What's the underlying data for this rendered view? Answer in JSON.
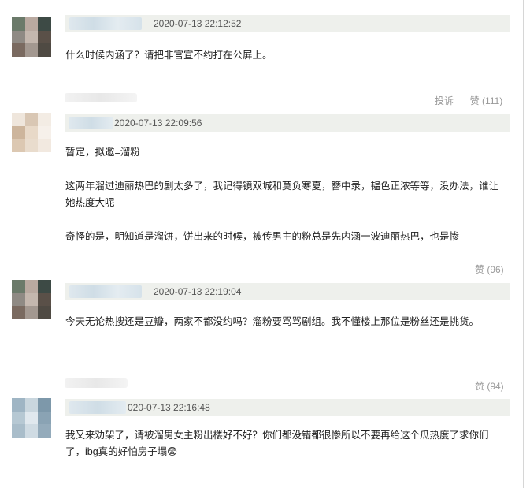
{
  "comments": [
    {
      "date": "2020-07-13 22:12:52",
      "lines": [
        "什么时候内涵了？请把非官宣不约打在公屏上。"
      ],
      "report_label": "投诉",
      "like_label": "赞 (111)",
      "avatar_colors": [
        "#6b7a6a",
        "#b9a9a0",
        "#3d4a45",
        "#8f8a84",
        "#c4b7ae",
        "#5a5048",
        "#7a6a60",
        "#a39890",
        "#4f4a43"
      ]
    },
    {
      "date": "2020-07-13 22:09:56",
      "lines": [
        "暂定，拟邀=溜粉",
        "这两年溜过迪丽热巴的剧太多了，我记得镜双城和莫负寒夏，簪中录，韫色正浓等等，没办法，谁让她热度大呢",
        "奇怪的是，明知道是溜饼，饼出来的时候，被传男主的粉总是先内涵一波迪丽热巴，也是惨"
      ],
      "like_label": "赞 (96)",
      "avatar_colors": [
        "#efe6dc",
        "#d9c7b4",
        "#f3ece4",
        "#cdb59c",
        "#e8d9c8",
        "#f6f0ea",
        "#dcc8b2",
        "#e9dccd",
        "#f2e9e0"
      ]
    },
    {
      "date": "2020-07-13 22:19:04",
      "lines": [
        "今天无论热搜还是豆瓣，两家不都没约吗？溜粉要骂骂剧组。我不懂楼上那位是粉丝还是挑货。"
      ],
      "like_label": "赞 (94)",
      "avatar_colors": [
        "#6b7a6a",
        "#b9a9a0",
        "#3d4a45",
        "#8f8a84",
        "#c4b7ae",
        "#5a5048",
        "#7a6a60",
        "#a39890",
        "#4f4a43"
      ]
    },
    {
      "date": "020-07-13 22:16:48",
      "lines": [
        "我又来劝架了，请被溜男女主粉出楼好不好？你们都没错都很惨所以不要再给这个瓜热度了求你们了，ibg真的好怕房子塌😨"
      ],
      "avatar_colors": [
        "#9fb5c4",
        "#c9d6de",
        "#7d98aa",
        "#b6c8d3",
        "#e0e8ee",
        "#8aa3b4",
        "#a9bdca",
        "#cfdbe3",
        "#94abbb"
      ]
    }
  ]
}
